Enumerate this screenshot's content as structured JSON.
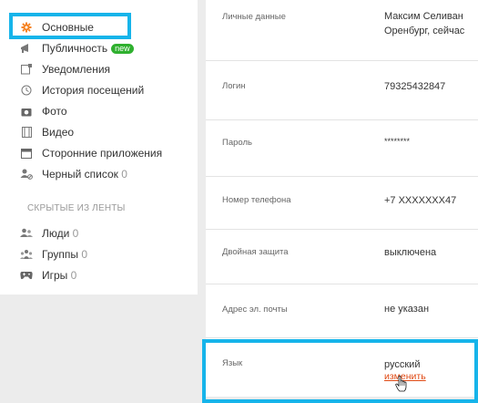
{
  "sidebar": {
    "items": [
      {
        "label": "Основные",
        "icon": "gear-icon"
      },
      {
        "label": "Публичность",
        "icon": "megaphone-icon",
        "badge": "new"
      },
      {
        "label": "Уведомления",
        "icon": "notification-icon"
      },
      {
        "label": "История посещений",
        "icon": "history-icon"
      },
      {
        "label": "Фото",
        "icon": "camera-icon"
      },
      {
        "label": "Видео",
        "icon": "film-icon"
      },
      {
        "label": "Сторонние приложения",
        "icon": "app-window-icon"
      },
      {
        "label": "Черный список",
        "icon": "blocked-user-icon",
        "count": "0"
      }
    ],
    "section_title": "СКРЫТЫЕ ИЗ ЛЕНТЫ",
    "hidden_items": [
      {
        "label": "Люди",
        "icon": "people-icon",
        "count": "0"
      },
      {
        "label": "Группы",
        "icon": "groups-icon",
        "count": "0"
      },
      {
        "label": "Игры",
        "icon": "gamepad-icon",
        "count": "0"
      }
    ]
  },
  "settings": {
    "personal": {
      "label": "Личные данные",
      "value_line1": "Максим Селиван",
      "value_line2": "Оренбург, сейчас"
    },
    "login": {
      "label": "Логин",
      "value": "79325432847"
    },
    "password": {
      "label": "Пароль",
      "value": "********"
    },
    "phone": {
      "label": "Номер телефона",
      "value": "+7 XXXXXXX47"
    },
    "two_factor": {
      "label": "Двойная защита",
      "value": "выключена"
    },
    "email": {
      "label": "Адрес эл. почты",
      "value": "не указан"
    },
    "language": {
      "label": "Язык",
      "value": "русский",
      "change_link": "изменить"
    }
  },
  "colors": {
    "highlight": "#16b4ea",
    "accent": "#e04a14",
    "badge": "#2fb02f",
    "active_icon": "#f58220"
  }
}
